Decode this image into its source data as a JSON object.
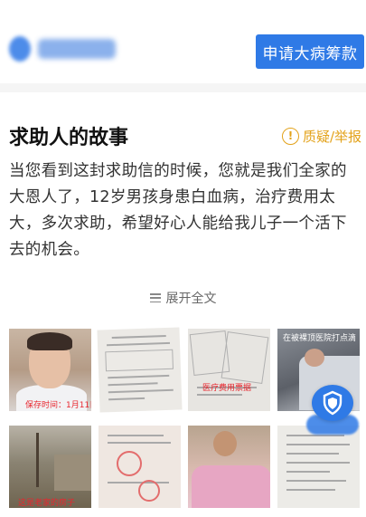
{
  "header": {
    "apply_button": "申请大病筹款"
  },
  "story": {
    "title": "求助人的故事",
    "report_label": "质疑/举报",
    "body": "当您看到这封求助信的时候，您就是我们全家的大恩人了，12岁男孩身患白血病，治疗费用太大，多次求助，希望好心人能给我儿子一个活下去的机会。",
    "expand_label": "展开全文"
  },
  "photos": {
    "p1_caption": "保存时间：1月11日",
    "p3_caption": "医疗费用票据",
    "p4_caption": "在被裸顶医院打点滴",
    "p5_caption": "这是老家的房子"
  },
  "colors": {
    "accent": "#2f7ae6",
    "report": "#e3a21a",
    "caption": "#e8262e"
  }
}
